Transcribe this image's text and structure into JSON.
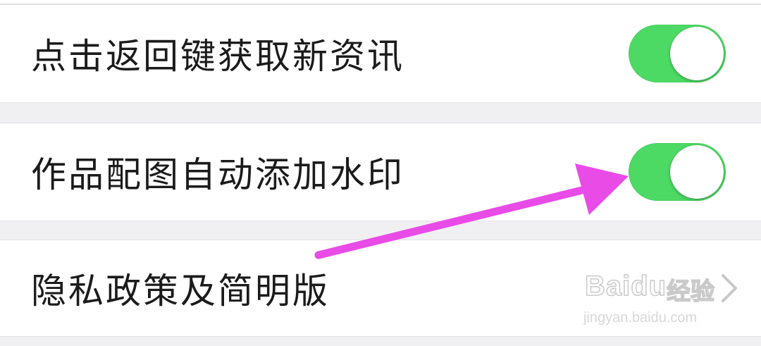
{
  "settings": {
    "items": [
      {
        "label": "点击返回键获取新资讯",
        "toggle_on": true
      },
      {
        "label": "作品配图自动添加水印",
        "toggle_on": true
      },
      {
        "label": "隐私政策及简明版"
      }
    ]
  },
  "watermark": {
    "brand": "Baidu",
    "brand_cn": "经验",
    "url": "jingyan.baidu.com"
  },
  "colors": {
    "toggle_on": "#4cd964",
    "annotation_arrow": "#e94be6",
    "background": "#f0f0f2",
    "row_background": "#ffffff"
  },
  "icons": {
    "disclosure": "chevron-right-icon"
  }
}
